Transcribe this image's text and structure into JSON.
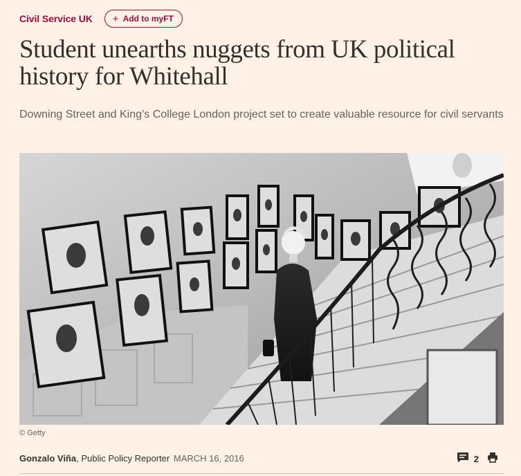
{
  "header": {
    "topic": "Civil Service UK",
    "myft_label": "Add to myFT"
  },
  "article": {
    "title": "Student unearths nuggets from UK political history for Whitehall",
    "standfirst": "Downing Street and King’s College London project set to create valuable resource for civil servants",
    "image_credit": "© Getty",
    "author": "Gonzalo Viña",
    "author_role": ", Public Policy Reporter",
    "date": "MARCH 16, 2016",
    "comment_count": "2"
  },
  "icons": {
    "myft": "plus-icon",
    "comments": "comment-bubble-icon",
    "print": "printer-icon"
  },
  "colors": {
    "background": "#fff1e5",
    "accent": "#990f3d",
    "text": "#33302e",
    "muted": "#66605c"
  }
}
